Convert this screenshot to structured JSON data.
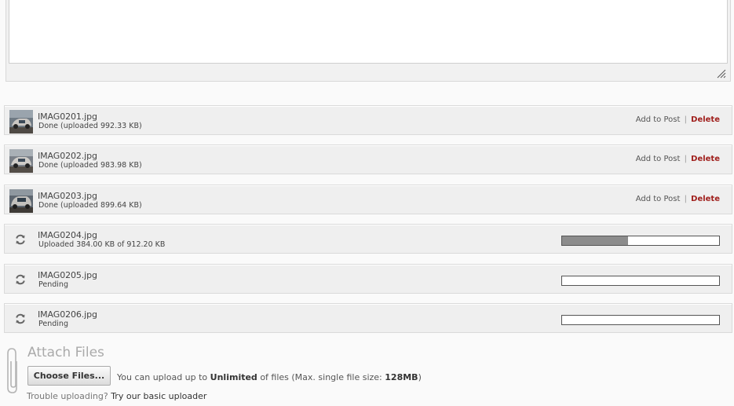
{
  "files": [
    {
      "name": "IMAG0201.jpg",
      "status": "Done (uploaded 992.33 KB)",
      "state": "done",
      "progress": null
    },
    {
      "name": "IMAG0202.jpg",
      "status": "Done (uploaded 983.98 KB)",
      "state": "done",
      "progress": null
    },
    {
      "name": "IMAG0203.jpg",
      "status": "Done (uploaded 899.64 KB)",
      "state": "done",
      "progress": null
    },
    {
      "name": "IMAG0204.jpg",
      "status": "Uploaded 384.00 KB of 912.20 KB",
      "state": "uploading",
      "progress": 0.421
    },
    {
      "name": "IMAG0205.jpg",
      "status": "Pending",
      "state": "pending",
      "progress": 0
    },
    {
      "name": "IMAG0206.jpg",
      "status": "Pending",
      "state": "pending",
      "progress": 0
    }
  ],
  "actions": {
    "add_label": "Add to Post",
    "separator": "|",
    "delete_label": "Delete"
  },
  "attach": {
    "title": "Attach Files",
    "choose_label": "Choose Files...",
    "info_prefix": "You can upload up to",
    "info_limit": "Unlimited",
    "info_middle": "of files (Max. single file size:",
    "info_size": "128MB",
    "info_suffix": ")",
    "trouble_text": "Trouble uploading?",
    "basic_link": "Try our basic uploader"
  },
  "colors": {
    "delete": "#a0201d",
    "progress_fill": "#8c8c8c",
    "row_bg": "#efefef"
  },
  "icons": {
    "spinner": "refresh-icon",
    "attach": "paperclip-icon",
    "resize": "resize-grip-icon"
  }
}
